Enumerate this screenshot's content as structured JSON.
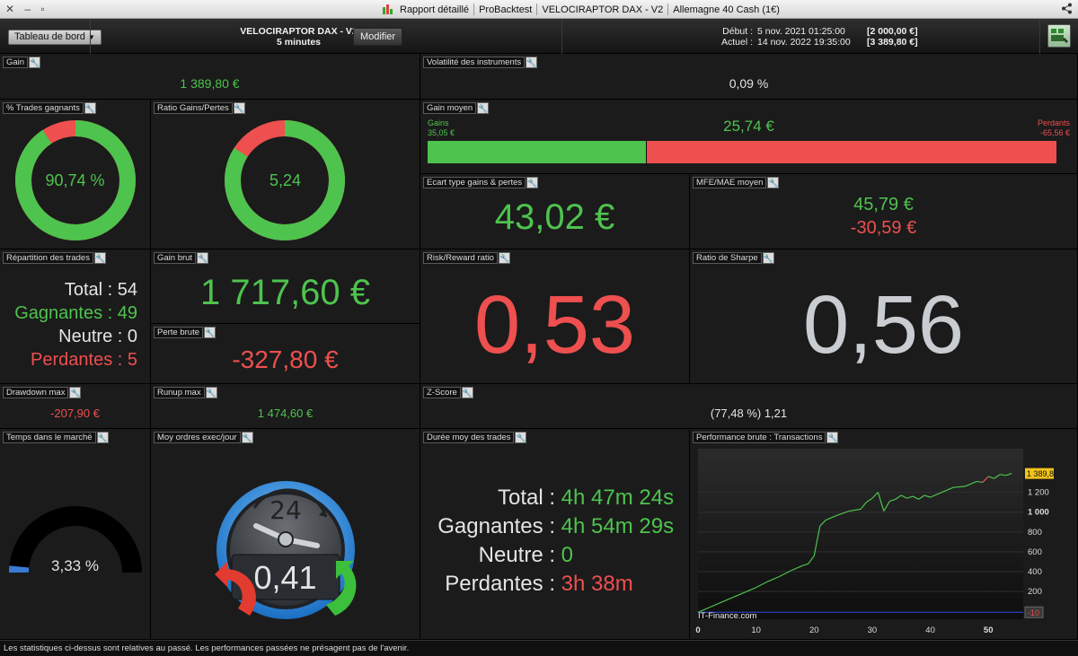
{
  "titlebar": {
    "items": [
      "Rapport détaillé",
      "ProBacktest",
      "VELOCIRAPTOR DAX - V2",
      "Allemagne 40 Cash (1€)"
    ]
  },
  "toolbar": {
    "dashboard_label": "Tableau de bord",
    "strategy_name": "VELOCIRAPTOR DAX - V2",
    "timeframe": "5 minutes",
    "modify_label": "Modifier",
    "start_label": "Début :",
    "start_date": "5 nov. 2021 01:25:00",
    "start_capital": "[2 000,00 €]",
    "current_label": "Actuel :",
    "current_date": "14 nov. 2022 19:35:00",
    "current_capital": "[3 389,80 €]"
  },
  "panels": {
    "gain": {
      "title": "Gain",
      "value": "1 389,80 €"
    },
    "volatility": {
      "title": "Volatilité des instruments",
      "value": "0,09 %"
    },
    "win_pct": {
      "title": "% Trades gagnants",
      "value": "90,74 %",
      "fraction": 0.9074
    },
    "ratio_gp": {
      "title": "Ratio Gains/Pertes",
      "value": "5,24",
      "fraction": 0.8397
    },
    "avg_gain": {
      "title": "Gain moyen",
      "value": "25,74 €",
      "gains_label": "Gains",
      "gains_value": "35,05 €",
      "losses_label": "Perdants",
      "losses_value": "-65,56 €",
      "gains_share": 0.3484
    },
    "std_dev": {
      "title": "Ecart type gains & pertes",
      "value": "43,02 €"
    },
    "mfe_mae": {
      "title": "MFE/MAE moyen",
      "mfe": "45,79 €",
      "mae": "-30,59 €"
    },
    "distribution": {
      "title": "Répartition des trades",
      "rows": [
        {
          "label": "Total :",
          "value": "54"
        },
        {
          "label": "Gagnantes :",
          "value": "49"
        },
        {
          "label": "Neutre :",
          "value": "0"
        },
        {
          "label": "Perdantes :",
          "value": "5"
        }
      ]
    },
    "gross_gain": {
      "title": "Gain brut",
      "value": "1 717,60 €"
    },
    "gross_loss": {
      "title": "Perte brute",
      "value": "-327,80 €"
    },
    "risk_reward": {
      "title": "Risk/Reward ratio",
      "value": "0,53"
    },
    "sharpe": {
      "title": "Ratio de Sharpe",
      "value": "0,56"
    },
    "drawdown": {
      "title": "Drawdown max",
      "value": "-207,90 €"
    },
    "runup": {
      "title": "Runup max",
      "value": "1 474,60 €"
    },
    "zscore": {
      "title": "Z-Score",
      "value": "(77,48 %) 1,21"
    },
    "time_in_market": {
      "title": "Temps dans le marché",
      "value": "3,33 %",
      "fraction": 0.0333
    },
    "orders_per_day": {
      "title": "Moy ordres exec/jour",
      "value": "0,41",
      "clock_label": "24"
    },
    "avg_duration": {
      "title": "Durée moy des trades",
      "rows": [
        {
          "label": "Total :",
          "value": "4h 47m 24s"
        },
        {
          "label": "Gagnantes :",
          "value": "4h 54m 29s"
        },
        {
          "label": "Neutre :",
          "value": "0"
        },
        {
          "label": "Perdantes :",
          "value": "3h 38m"
        }
      ]
    },
    "performance": {
      "title": "Performance brute : Transactions",
      "watermark": "IT-Finance.com",
      "last_value_label": "1 389,8",
      "min_label": "-10"
    }
  },
  "footer": {
    "text": "Les statistiques ci-dessus sont relatives au passé. Les performances passées ne présagent pas de l'avenir."
  },
  "colors": {
    "green": "#4ec34e",
    "red": "#ee4f4f",
    "background": "#1b1b1b"
  },
  "chart_data": {
    "type": "line",
    "title": "Performance brute : Transactions",
    "xlabel": "",
    "ylabel": "",
    "xlim": [
      0,
      56
    ],
    "ylim": [
      -80,
      1640
    ],
    "x_ticks": [
      0,
      10,
      20,
      30,
      40,
      50
    ],
    "y_ticks": [
      200,
      400,
      600,
      800,
      1000,
      1200
    ],
    "y_tick_labels": [
      "200",
      "400",
      "600",
      "800",
      "1 000",
      "1 200"
    ],
    "series": [
      {
        "x": [
          0,
          2,
          4,
          6,
          8,
          10,
          12,
          14,
          16,
          18,
          19,
          20,
          21,
          22,
          24,
          26,
          28,
          29,
          30,
          31,
          32,
          33,
          34,
          35,
          36,
          37,
          38,
          39,
          40,
          42,
          44,
          46,
          48,
          49,
          50,
          51,
          52,
          53,
          54
        ],
        "y": [
          -10,
          40,
          90,
          140,
          190,
          240,
          300,
          350,
          410,
          460,
          480,
          560,
          860,
          920,
          970,
          1010,
          1030,
          1100,
          1140,
          1200,
          1010,
          1110,
          1130,
          1170,
          1140,
          1160,
          1130,
          1170,
          1150,
          1200,
          1250,
          1260,
          1310,
          1300,
          1360,
          1340,
          1380,
          1370,
          1390
        ],
        "losing_segments": [
          [
            30,
            32
          ],
          [
            34,
            36
          ],
          [
            36,
            38
          ],
          [
            49,
            50
          ]
        ]
      }
    ],
    "baseline_value": -10
  }
}
